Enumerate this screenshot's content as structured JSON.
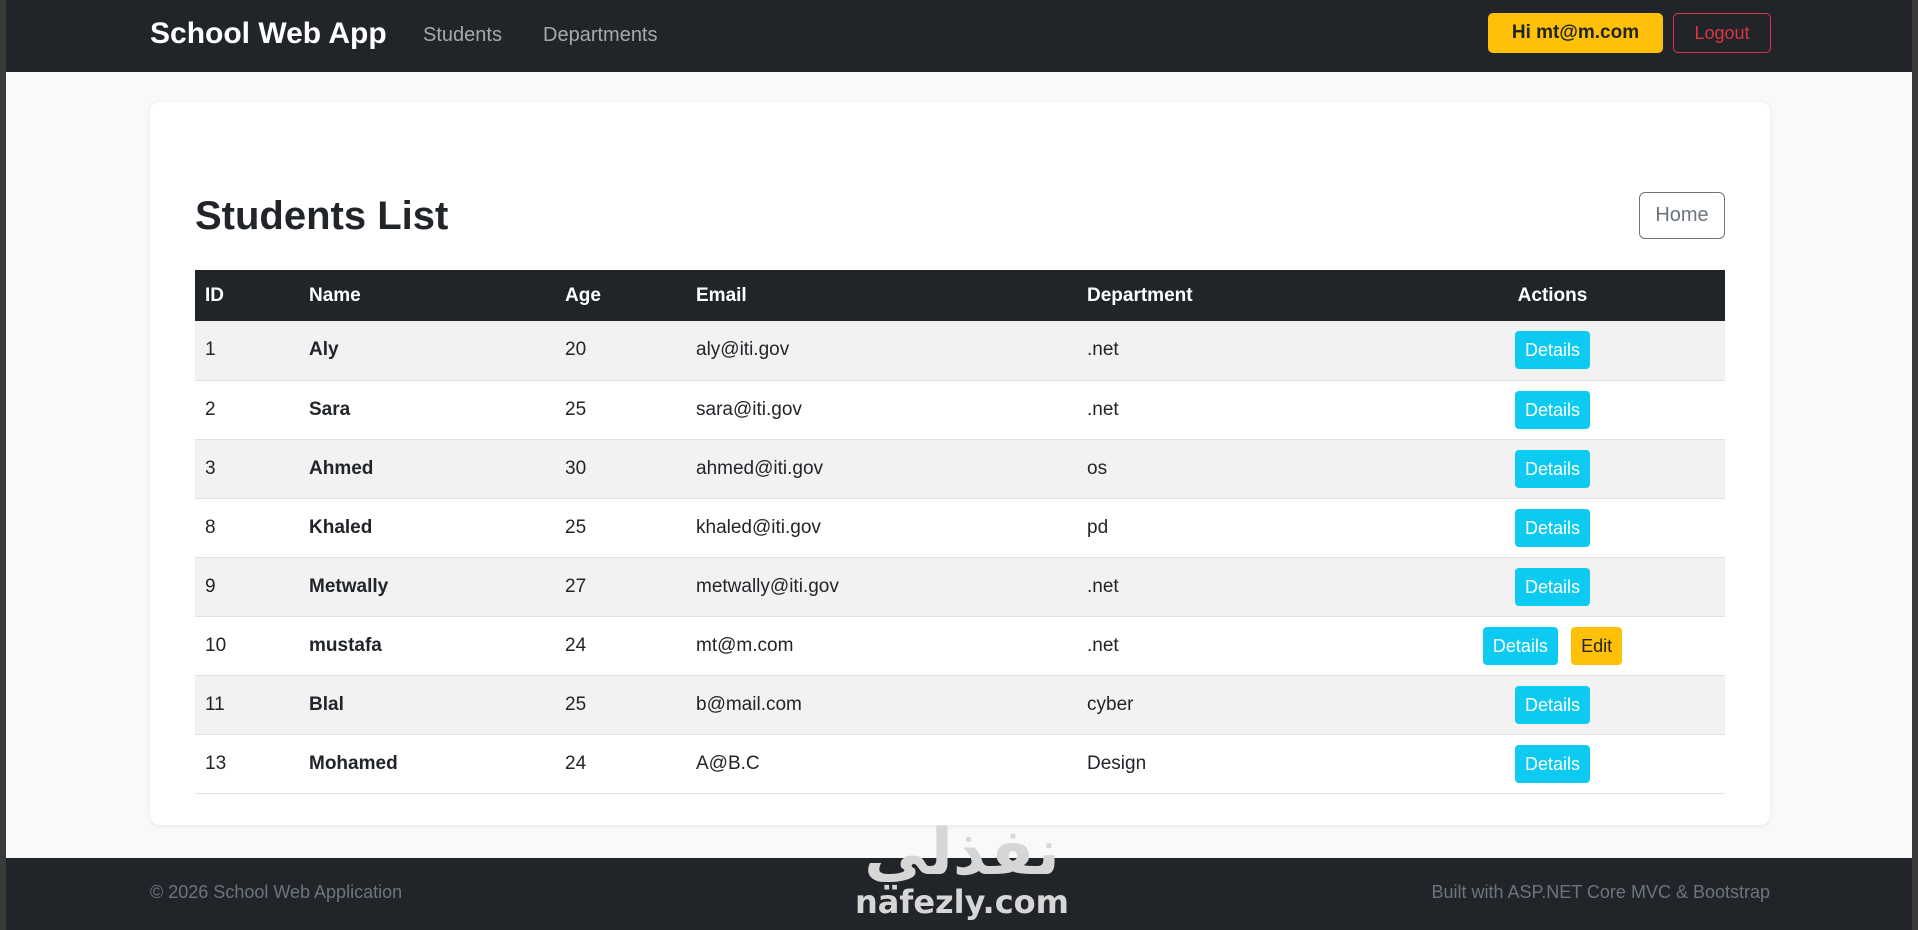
{
  "navbar": {
    "brand": "School Web App",
    "links": [
      "Students",
      "Departments"
    ],
    "user_button": "Hi mt@m.com",
    "logout_button": "Logout"
  },
  "main": {
    "title": "Students List",
    "home_button": "Home",
    "table": {
      "headers": [
        "ID",
        "Name",
        "Age",
        "Email",
        "Department",
        "Actions"
      ],
      "rows": [
        {
          "id": "1",
          "name": "Aly",
          "age": "20",
          "email": "aly@iti.gov",
          "department": ".net",
          "actions": [
            "Details"
          ]
        },
        {
          "id": "2",
          "name": "Sara",
          "age": "25",
          "email": "sara@iti.gov",
          "department": ".net",
          "actions": [
            "Details"
          ]
        },
        {
          "id": "3",
          "name": "Ahmed",
          "age": "30",
          "email": "ahmed@iti.gov",
          "department": "os",
          "actions": [
            "Details"
          ]
        },
        {
          "id": "8",
          "name": "Khaled",
          "age": "25",
          "email": "khaled@iti.gov",
          "department": "pd",
          "actions": [
            "Details"
          ]
        },
        {
          "id": "9",
          "name": "Metwally",
          "age": "27",
          "email": "metwally@iti.gov",
          "department": ".net",
          "actions": [
            "Details"
          ]
        },
        {
          "id": "10",
          "name": "mustafa",
          "age": "24",
          "email": "mt@m.com",
          "department": ".net",
          "actions": [
            "Details",
            "Edit"
          ]
        },
        {
          "id": "11",
          "name": "Blal",
          "age": "25",
          "email": "b@mail.com",
          "department": "cyber",
          "actions": [
            "Details"
          ]
        },
        {
          "id": "13",
          "name": "Mohamed",
          "age": "24",
          "email": "A@B.C",
          "department": "Design",
          "actions": [
            "Details"
          ]
        }
      ]
    }
  },
  "footer": {
    "copyright": "© 2026 School Web Application",
    "built_with": "Built with ASP.NET Core MVC & Bootstrap"
  },
  "watermark": {
    "arabic": "نفذلي",
    "latin": "nafezly.com"
  },
  "colors": {
    "navbar_bg": "#212529",
    "warning": "#ffc107",
    "danger": "#dc3545",
    "info": "#0dcaf0",
    "secondary": "#6c757d"
  }
}
